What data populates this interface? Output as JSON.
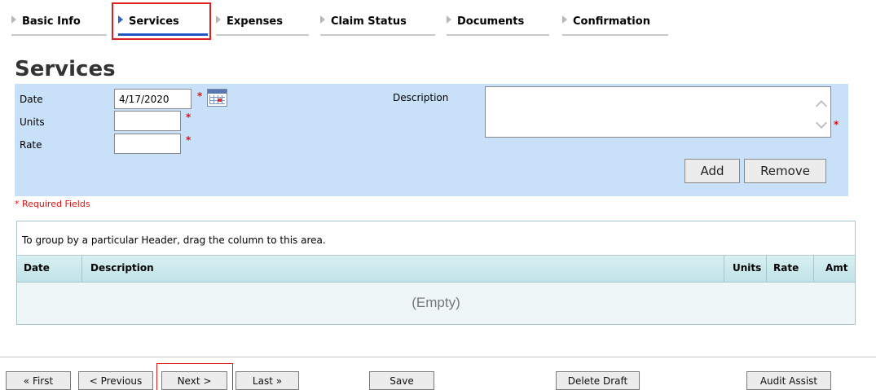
{
  "tabs": [
    {
      "label": "Basic Info"
    },
    {
      "label": "Services"
    },
    {
      "label": "Expenses"
    },
    {
      "label": "Claim Status"
    },
    {
      "label": "Documents"
    },
    {
      "label": "Confirmation"
    }
  ],
  "active_tab": "Services",
  "section_title": "Services",
  "form": {
    "date_label": "Date",
    "date_value": "4/17/2020",
    "units_label": "Units",
    "units_value": "",
    "rate_label": "Rate",
    "rate_value": "",
    "description_label": "Description",
    "description_value": "",
    "required_marker": "*",
    "add_label": "Add",
    "remove_label": "Remove"
  },
  "required_note": "* Required Fields",
  "grid": {
    "group_hint": "To group by a particular Header, drag the column to this area.",
    "columns": [
      "Date",
      "Description",
      "Units",
      "Rate",
      "Amt"
    ],
    "empty_text": "(Empty)"
  },
  "nav": {
    "first": "« First",
    "previous": "< Previous",
    "next": "Next >",
    "last": "Last »",
    "save": "Save",
    "delete_draft": "Delete Draft",
    "audit_assist": "Audit Assist"
  },
  "colors": {
    "panel_bg": "#c8e0f8",
    "required": "#e01010",
    "highlight": "#e02020",
    "active_tab_underline": "#1f57c8"
  },
  "icons": [
    "tab-arrow-icon",
    "calendar-icon",
    "scroll-up-icon",
    "scroll-down-icon"
  ]
}
